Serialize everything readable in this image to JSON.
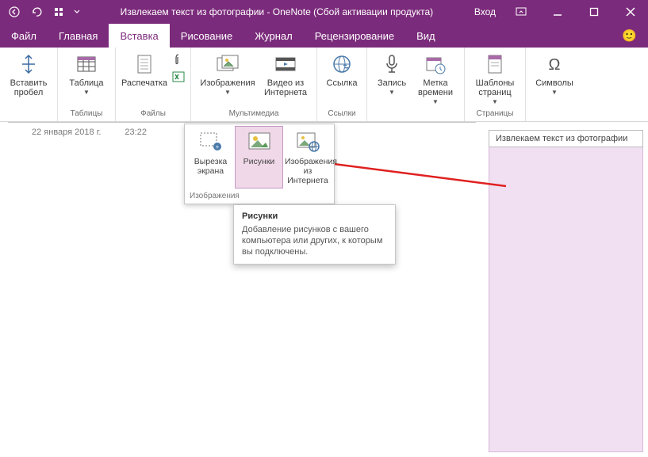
{
  "titlebar": {
    "title": "Извлекаем текст из фотографии  -  OneNote (Сбой активации продукта)",
    "login": "Вход"
  },
  "tabs": {
    "file": "Файл",
    "home": "Главная",
    "insert": "Вставка",
    "draw": "Рисование",
    "history": "Журнал",
    "review": "Рецензирование",
    "view": "Вид"
  },
  "ribbon": {
    "insert_space": {
      "label": "Вставить\nпробел",
      "group": ""
    },
    "tables": {
      "label": "Таблица",
      "group": "Таблицы"
    },
    "files": {
      "printout": "Распечатка",
      "group": "Файлы"
    },
    "images": {
      "label": "Изображения",
      "group": "Мультимедиа"
    },
    "video": {
      "label": "Видео из\nИнтернета"
    },
    "link": {
      "label": "Ссылка",
      "group": "Ссылки"
    },
    "record": {
      "label": "Запись"
    },
    "timestamp": {
      "label": "Метка\nвремени"
    },
    "pages": {
      "label": "Шаблоны\nстраниц",
      "group": "Страницы"
    },
    "symbols": {
      "label": "Символы"
    }
  },
  "gallery": {
    "screenclip": "Вырезка\nэкрана",
    "pictures": "Рисунки",
    "online": "Изображения\nиз Интернета",
    "section": "Изображения"
  },
  "tooltip": {
    "title": "Рисунки",
    "desc": "Добавление рисунков с вашего компьютера или других, к которым вы подключены."
  },
  "page": {
    "date": "22 января 2018 г.",
    "time": "23:22",
    "pagetitle": "Извлекаем текст из фотографии"
  }
}
